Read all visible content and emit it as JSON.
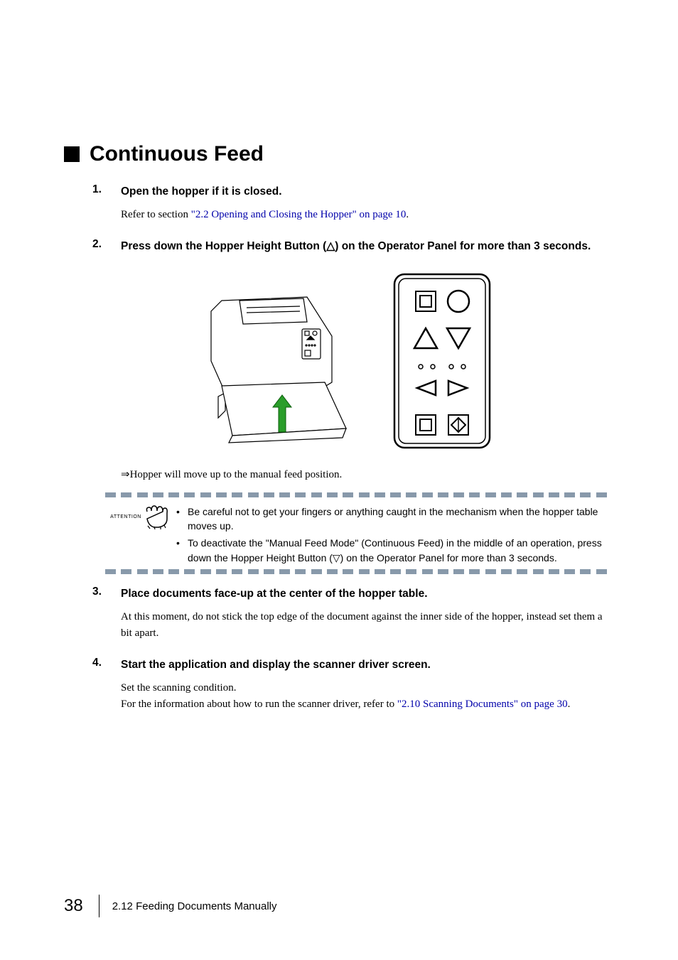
{
  "section": {
    "title": "Continuous Feed"
  },
  "steps": [
    {
      "num": "1.",
      "label": "Open the hopper if it is closed.",
      "body_prefix": "Refer to section ",
      "body_link": "\"2.2 Opening and Closing the Hopper\" on page 10",
      "body_suffix": "."
    },
    {
      "num": "2.",
      "label": "Press down the Hopper Height Button (△) on the Operator Panel for more than 3 seconds."
    },
    {
      "num": "3.",
      "label": "Place documents face-up at the center of the hopper table.",
      "body_plain": "At this moment, do not stick the top edge of the document against the inner side of the hopper, instead set them a bit apart."
    },
    {
      "num": "4.",
      "label": "Start the application and display the scanner driver screen.",
      "body_line1": "Set the scanning condition.",
      "body_line2_prefix": "For the information about how to run the scanner driver, refer to ",
      "body_line2_link": "\"2.10 Scanning Documents\" on page 30",
      "body_line2_suffix": "."
    }
  ],
  "result": "⇒Hopper will move up to the manual feed position.",
  "attention": {
    "label": "ATTENTION",
    "items": [
      "Be careful not to get your fingers or anything caught in the mechanism when the hopper table moves up.",
      "To deactivate the \"Manual Feed Mode\" (Continuous Feed) in the middle of an operation, press down the Hopper Height Button (▽) on the Operator Panel for more than 3 seconds."
    ]
  },
  "footer": {
    "page": "38",
    "text": "2.12 Feeding Documents Manually"
  },
  "icons": {
    "scanner": "scanner-illustration",
    "panel": "operator-panel-illustration"
  }
}
